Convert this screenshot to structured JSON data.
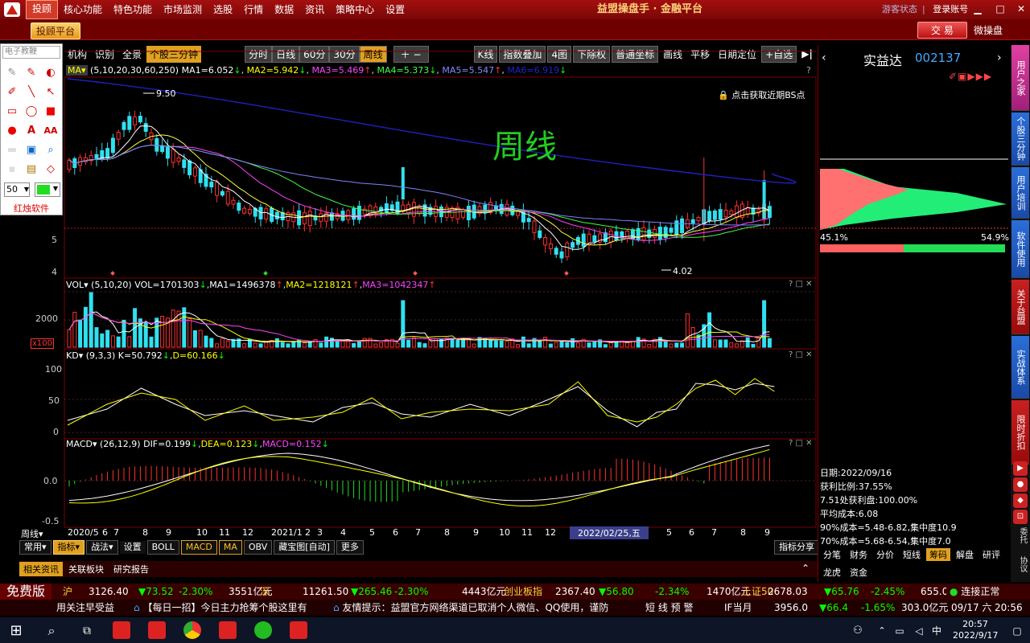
{
  "menubar": {
    "items": [
      "投顾",
      "核心功能",
      "特色功能",
      "市场监测",
      "选股",
      "行情",
      "数据",
      "资讯",
      "策略中心",
      "设置"
    ],
    "title": "益盟操盘手 · 金融平台",
    "guest": "游客状态",
    "login": "登录账号",
    "trade": "交 易",
    "wechat": "微操盘",
    "platform": "投顾平台"
  },
  "drawtool": {
    "title": "电子教鞭",
    "size": "50",
    "brand": "红烛软件"
  },
  "toolbar": {
    "left": [
      "机构",
      "识别",
      "全景",
      "个股三分钟"
    ],
    "periods": [
      "分时",
      "日线",
      "60分",
      "30分",
      "周线"
    ],
    "right": [
      "K线",
      "指数叠加",
      "4图",
      "下除权",
      "普通坐标",
      "画线",
      "平移",
      "日期定位",
      "+自选"
    ]
  },
  "main": {
    "ma_info": "(5,10,20,30,60,250)",
    "ma1": "MA1=6.052",
    "ma2": "MA2=5.942",
    "ma3": "MA3=5.469",
    "ma4": "MA4=5.373",
    "ma5": "MA5=5.547",
    "ma6": "MA6=6.919",
    "hi": "9.50",
    "lo": "4.02",
    "watermark": "周线",
    "bs": "点击获取近期BS点",
    "yticks": [
      "5",
      "4"
    ]
  },
  "vol": {
    "label": "VOL",
    "params": "(5,10,20)",
    "v": "VOL=1701303",
    "ma1": "MA1=1496378",
    "ma2": "MA2=1218121",
    "ma3": "MA3=1042347",
    "ytick": "2000",
    "unit": "x100"
  },
  "kd": {
    "label": "KD",
    "params": "(9,3,3)",
    "k": "K=50.792",
    "d": "D=60.166",
    "yticks": [
      "100",
      "50",
      "0"
    ]
  },
  "macd": {
    "label": "MACD",
    "params": "(26,12,9)",
    "dif": "DIF=0.199",
    "dea": "DEA=0.123",
    "macd": "MACD=0.152",
    "yticks": [
      "0.0",
      "-0.5"
    ]
  },
  "xaxis": {
    "period": "周线",
    "labels": [
      "2020/5",
      "6",
      "7",
      "8",
      "9",
      "10",
      "11",
      "12",
      "2021/1",
      "2",
      "3",
      "4",
      "5",
      "6",
      "7",
      "8",
      "9",
      "10",
      "11",
      "12",
      "5",
      "6",
      "7",
      "8",
      "9"
    ],
    "cursor": "2022/02/25,五"
  },
  "bottom": {
    "tabs": [
      "常用",
      "指标",
      "战法"
    ],
    "setting": "设置",
    "inds": [
      "BOLL",
      "MACD",
      "MA",
      "OBV",
      "藏宝图[自动]",
      "更多"
    ],
    "share": "指标分享",
    "links": [
      "相关资讯",
      "关联板块",
      "研究报告"
    ]
  },
  "right": {
    "stock": "实益达",
    "code": "002137",
    "lpct": "45.1%",
    "rpct": "54.9%",
    "date": "日期:2022/09/16",
    "profit": "获利比例:37.55%",
    "profit2": "7.51处获利盘:100.00%",
    "avg": "平均成本:6.08",
    "c90": "90%成本=5.48-6.82,集中度10.9",
    "c70": "70%成本=5.68-6.54,集中度7.0",
    "tabs1": [
      "分笔",
      "财务",
      "分价",
      "短线",
      "筹码",
      "解盘",
      "研评"
    ],
    "tabs2": [
      "龙虎",
      "资金"
    ]
  },
  "rtabs": [
    "用户之家",
    "个股三分钟",
    "用户培训",
    "软件使用",
    "关于益盟",
    "实战体系",
    "限时折扣"
  ],
  "ricons": [
    "委托",
    "协议"
  ],
  "ticker": {
    "free": "免费版",
    "items": [
      [
        "沪",
        "3126.40",
        "▼73.52",
        "-2.30%",
        "3551亿元"
      ],
      [
        "深",
        "11261.50",
        "▼265.46",
        "-2.30%",
        "4443亿元"
      ],
      [
        "创业板指",
        "2367.40",
        "▼56.80",
        "-2.34%",
        "1470亿元"
      ],
      [
        "上证50",
        "2678.03",
        "▼65.76",
        "-2.45%",
        "655.0亿元"
      ]
    ],
    "status": "连接正常"
  },
  "news": {
    "items": [
      "用关注早受益",
      "【每日一招】今日主力抢筹个股这里有",
      "友情提示：益盟官方网络渠道已取消个人微信、QQ使用，谨防",
      "短 线 预 警"
    ],
    "if": "IF当月",
    "ifv": "3956.0",
    "ifc": "▼66.4",
    "ifp": "-1.65%",
    "ifa": "303.0亿元",
    "date": "09/17 六",
    "time": "20:56"
  },
  "taskbar": {
    "time": "20:57",
    "date": "2022/9/17",
    "ime": "中"
  },
  "colors": {
    "up": "#ff3030",
    "down": "#30e0f0",
    "ma1": "#ffffff",
    "ma2": "#ffff40",
    "ma3": "#ff40ff",
    "ma4": "#40ff40",
    "ma5": "#8080ff",
    "ma6": "#2020c0"
  }
}
